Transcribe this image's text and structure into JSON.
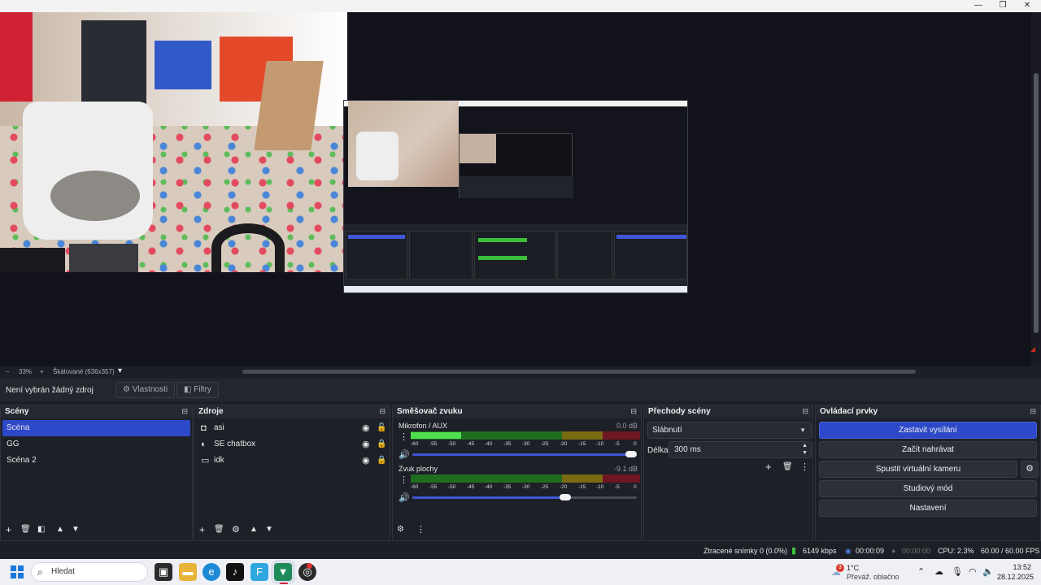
{
  "window": {
    "controls": {
      "minimize": "—",
      "maximize": "❐",
      "close": "✕"
    }
  },
  "zoom": {
    "minus": "−",
    "percent": "33%",
    "plus": "+",
    "scale_mode": "Škálované (636x357)",
    "menu": "▾"
  },
  "context": {
    "no_source": "Není vybrán žádný zdroj",
    "properties": "Vlastnosti",
    "filters": "Filtry"
  },
  "scenes": {
    "title": "Scény",
    "items": [
      {
        "label": "Scéna",
        "selected": true
      },
      {
        "label": "GG",
        "selected": false
      },
      {
        "label": "Scéna 2",
        "selected": false
      }
    ]
  },
  "sources": {
    "title": "Zdroje",
    "items": [
      {
        "label": "asi",
        "icon": "camera-icon",
        "locked": false
      },
      {
        "label": "SE chatbox",
        "icon": "globe-icon",
        "locked": true
      },
      {
        "label": "idk",
        "icon": "monitor-icon",
        "locked": true
      }
    ]
  },
  "mixer": {
    "title": "Směšovač zvuku",
    "channels": [
      {
        "name": "Mikrofon / AUX",
        "db": "0.0 dB",
        "level": 0.22,
        "volume": 1.0
      },
      {
        "name": "Zvuk plochy",
        "db": "-9.1 dB",
        "level": 0.0,
        "volume": 0.68
      }
    ],
    "ticks": [
      "-60",
      "-55",
      "-50",
      "-45",
      "-40",
      "-35",
      "-30",
      "-25",
      "-20",
      "-15",
      "-10",
      "-5",
      "0"
    ]
  },
  "transitions": {
    "title": "Přechody scény",
    "selected": "Slábnutí",
    "duration_label": "Délka",
    "duration_value": "300 ms"
  },
  "controls": {
    "title": "Ovládací prvky",
    "buttons": {
      "stop_stream": "Zastavit vysílání",
      "start_record": "Začít nahrávat",
      "virtual_cam": "Spustit virtuální kameru",
      "studio_mode": "Studiový mód",
      "settings": "Nastavení"
    }
  },
  "status": {
    "dropped_frames": "Ztracené snímky 0 (0.0%)",
    "bitrate": "6149 kbps",
    "stream_time": "00:00:09",
    "record_time": "00:00:00",
    "cpu": "CPU: 2.3%",
    "fps": "60.00 / 60.00 FPS"
  },
  "taskbar": {
    "search_placeholder": "Hledat",
    "weather_temp": "1°C",
    "weather_desc": "Převáž. oblačno",
    "weather_badge": "3",
    "time": "13:52",
    "date": "28.12.2025"
  },
  "colors": {
    "accent": "#2d49c9",
    "meter_green": "#3bbf3b",
    "meter_yellow": "#b59a1d",
    "meter_red": "#a82033"
  }
}
